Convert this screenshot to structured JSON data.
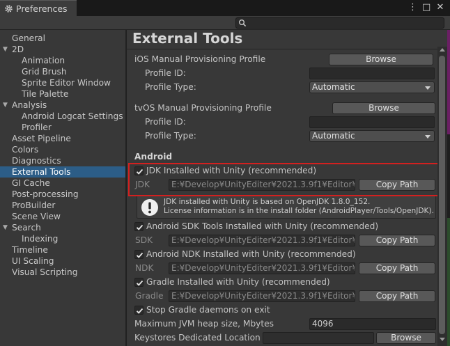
{
  "window": {
    "tab_title": "Preferences",
    "controls": [
      "⋮",
      "□",
      "✕"
    ],
    "gear_icon": "gear-icon"
  },
  "search": {
    "placeholder": "",
    "icon": "search-icon"
  },
  "sidebar": {
    "selected": "External Tools",
    "items": [
      {
        "label": "General",
        "level": 0,
        "expandable": false
      },
      {
        "label": "2D",
        "level": 0,
        "expandable": true
      },
      {
        "label": "Animation",
        "level": 1,
        "expandable": false
      },
      {
        "label": "Grid Brush",
        "level": 1,
        "expandable": false
      },
      {
        "label": "Sprite Editor Window",
        "level": 1,
        "expandable": false
      },
      {
        "label": "Tile Palette",
        "level": 1,
        "expandable": false
      },
      {
        "label": "Analysis",
        "level": 0,
        "expandable": true
      },
      {
        "label": "Android Logcat Settings",
        "level": 1,
        "expandable": false
      },
      {
        "label": "Profiler",
        "level": 1,
        "expandable": false
      },
      {
        "label": "Asset Pipeline",
        "level": 0,
        "expandable": false
      },
      {
        "label": "Colors",
        "level": 0,
        "expandable": false
      },
      {
        "label": "Diagnostics",
        "level": 0,
        "expandable": false
      },
      {
        "label": "External Tools",
        "level": 0,
        "expandable": false
      },
      {
        "label": "GI Cache",
        "level": 0,
        "expandable": false
      },
      {
        "label": "Post-processing",
        "level": 0,
        "expandable": false
      },
      {
        "label": "ProBuilder",
        "level": 0,
        "expandable": false
      },
      {
        "label": "Scene View",
        "level": 0,
        "expandable": false
      },
      {
        "label": "Search",
        "level": 0,
        "expandable": true
      },
      {
        "label": "Indexing",
        "level": 1,
        "expandable": false
      },
      {
        "label": "Timeline",
        "level": 0,
        "expandable": false
      },
      {
        "label": "UI Scaling",
        "level": 0,
        "expandable": false
      },
      {
        "label": "Visual Scripting",
        "level": 0,
        "expandable": false
      }
    ]
  },
  "main": {
    "title": "External Tools",
    "ios": {
      "label": "iOS Manual Provisioning Profile",
      "browse": "Browse",
      "profile_id_label": "Profile ID:",
      "profile_id_value": "",
      "profile_type_label": "Profile Type:",
      "profile_type_value": "Automatic"
    },
    "tvos": {
      "label": "tvOS Manual Provisioning Profile",
      "browse": "Browse",
      "profile_id_label": "Profile ID:",
      "profile_id_value": "",
      "profile_type_label": "Profile Type:",
      "profile_type_value": "Automatic"
    },
    "android": {
      "section_title": "Android",
      "jdk_check": "JDK Installed with Unity (recommended)",
      "jdk_label": "JDK",
      "jdk_path": "E:¥Develop¥UnityEditer¥2021.3.9f1¥Editor¥D",
      "copy_path": "Copy Path",
      "help_line1": "JDK installed with Unity is based on OpenJDK 1.8.0_152.",
      "help_line2": "License information is in the install folder (AndroidPlayer/Tools/OpenJDK).",
      "sdk_check": "Android SDK Tools Installed with Unity (recommended)",
      "sdk_label": "SDK",
      "sdk_path": "E:¥Develop¥UnityEditer¥2021.3.9f1¥Editor¥D",
      "ndk_check": "Android NDK Installed with Unity (recommended)",
      "ndk_label": "NDK",
      "ndk_path": "E:¥Develop¥UnityEditer¥2021.3.9f1¥Editor¥D",
      "gradle_check": "Gradle Installed with Unity (recommended)",
      "gradle_label": "Gradle",
      "gradle_path": "E:¥Develop¥UnityEditer¥2021.3.9f1¥Editor¥D",
      "stop_gradle": "Stop Gradle daemons on exit",
      "jvm_label": "Maximum JVM heap size, Mbytes",
      "jvm_value": "4096",
      "keystore_label": "Keystores Dedicated Location",
      "keystore_browse": "Browse"
    }
  },
  "colors": {
    "selection": "#2c5d87",
    "highlight_box": "#d3201f"
  }
}
